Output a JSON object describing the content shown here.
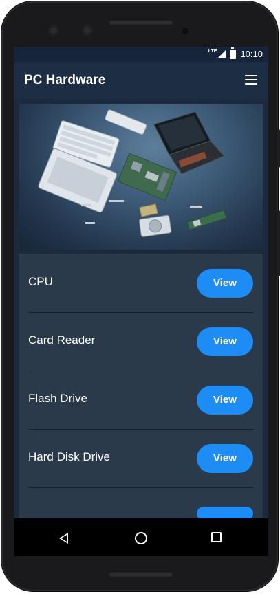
{
  "status_bar": {
    "network": "LTE",
    "time": "10:10"
  },
  "app_bar": {
    "title": "PC Hardware",
    "menu_icon": "hamburger-menu-icon"
  },
  "hero_image": {
    "subject": "exploded laptop components"
  },
  "hardware_list": [
    {
      "label": "CPU",
      "button": "View"
    },
    {
      "label": "Card Reader",
      "button": "View"
    },
    {
      "label": "Flash Drive",
      "button": "View"
    },
    {
      "label": "Hard Disk Drive",
      "button": "View"
    }
  ],
  "nav_bar": {
    "back_icon": "back-triangle-icon",
    "home_icon": "home-circle-icon",
    "recents_icon": "recents-square-icon"
  },
  "colors": {
    "app_bar": "#1d2e44",
    "list_background": "#2a3a4b",
    "accent_button": "#1e8cf5"
  }
}
